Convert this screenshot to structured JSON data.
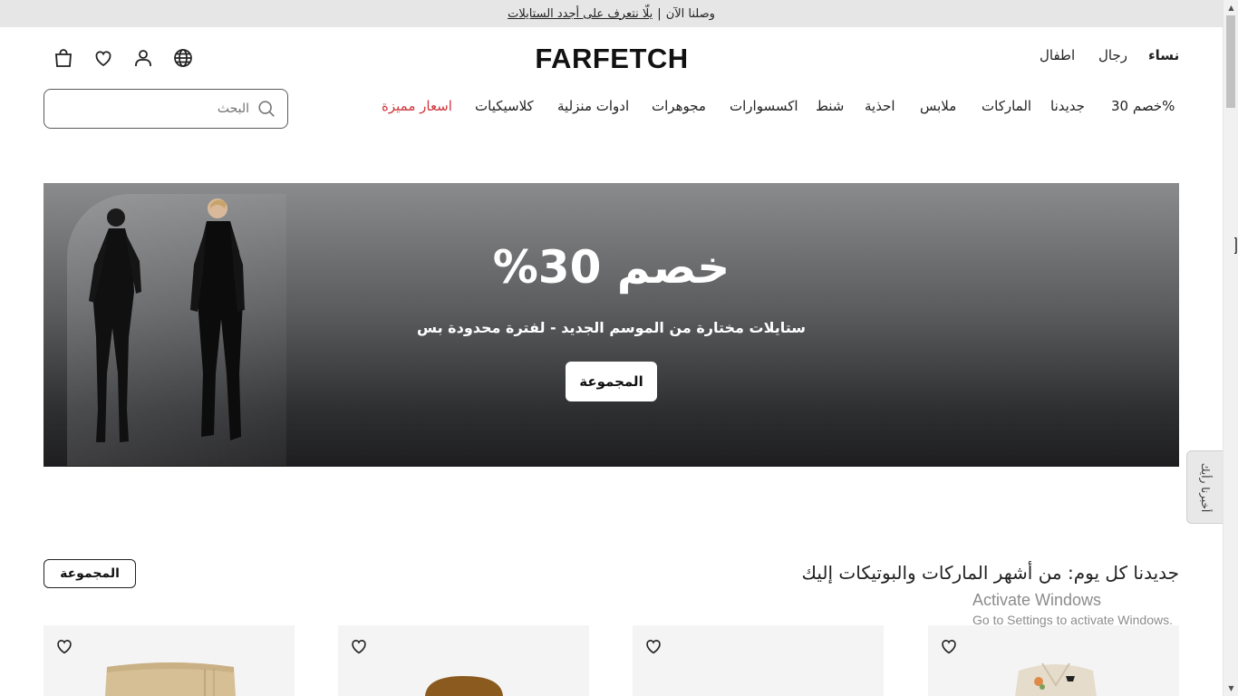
{
  "announcement": {
    "prefix": "وصلنا الآن",
    "separator": "|",
    "link": "يلّا نتعرف على أجدد الستايلات"
  },
  "header": {
    "logo": "FARFETCH",
    "gender_tabs": [
      "نساء",
      "رجال",
      "اطفال"
    ],
    "active_gender": "نساء",
    "icons": [
      "globe-icon",
      "account-icon",
      "wishlist-heart-icon",
      "shopping-bag-icon"
    ]
  },
  "nav": {
    "items": [
      "خصم 30%",
      "جديدنا",
      "الماركات",
      "ملابس",
      "احذية",
      "شنط",
      "اكسسوارات",
      "مجوهرات",
      "ادوات منزلية",
      "كلاسيكيات",
      "اسعار مميزة"
    ],
    "highlight_color": "#d0363c"
  },
  "search": {
    "placeholder": "البحث",
    "icon": "search-icon"
  },
  "hero": {
    "title": "خصم 30%",
    "subtitle": "ستايلات مختارة من الموسم الجديد - لفترة محدودة بس",
    "cta": "المجموعة"
  },
  "feedback": {
    "label": "أخبرنا رأيك"
  },
  "section": {
    "title": "جديدنا كل يوم: من أشهر الماركات والبوتيكات إليك",
    "cta": "المجموعة"
  },
  "products": [
    {
      "image": "beige-trousers",
      "wishlist_icon": "heart-icon"
    },
    {
      "image": "brown-knit",
      "wishlist_icon": "heart-icon"
    },
    {
      "image": "blank",
      "wishlist_icon": "heart-icon"
    },
    {
      "image": "cream-jacket-with-brooch",
      "wishlist_icon": "heart-icon"
    }
  ],
  "os_watermark": {
    "line1": "Activate Windows",
    "line2": "Go to Settings to activate Windows."
  }
}
